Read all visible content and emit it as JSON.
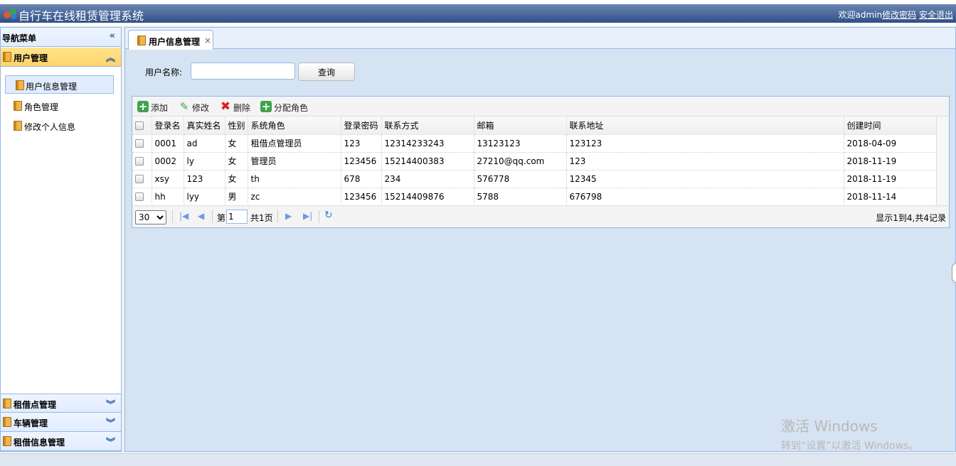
{
  "header": {
    "title": "自行车在线租赁管理系统",
    "welcome": "欢迎admin",
    "change_password": "修改密码",
    "logout": "安全退出"
  },
  "sidebar": {
    "nav_title": "导航菜单",
    "sections": [
      {
        "label": "用户管理",
        "expanded": true
      },
      {
        "label": "租借点管理",
        "expanded": false
      },
      {
        "label": "车辆管理",
        "expanded": false
      },
      {
        "label": "租借信息管理",
        "expanded": false
      }
    ],
    "items": [
      {
        "label": "用户信息管理",
        "selected": true
      },
      {
        "label": "角色管理",
        "selected": false
      },
      {
        "label": "修改个人信息",
        "selected": false
      }
    ]
  },
  "tabs": [
    {
      "label": "用户信息管理",
      "closable": true
    }
  ],
  "search": {
    "label": "用户名称:",
    "value": "",
    "button": "查询"
  },
  "toolbar": {
    "add": "添加",
    "edit": "修改",
    "delete": "删除",
    "assign_role": "分配角色"
  },
  "table": {
    "columns": [
      "登录名",
      "真实姓名",
      "性别",
      "系统角色",
      "登录密码",
      "联系方式",
      "邮箱",
      "联系地址",
      "创建时间"
    ],
    "rows": [
      [
        "0001",
        "ad",
        "女",
        "租借点管理员",
        "123",
        "12314233243",
        "13123123",
        "123123",
        "2018-04-09"
      ],
      [
        "0002",
        "ly",
        "女",
        "管理员",
        "123456",
        "15214400383",
        "27210@qq.com",
        "123",
        "2018-11-19"
      ],
      [
        "xsy",
        "123",
        "女",
        "th",
        "678",
        "234",
        "576778",
        "12345",
        "2018-11-19"
      ],
      [
        "hh",
        "lyy",
        "男",
        "zc",
        "123456",
        "15214409876",
        "5788",
        "676798",
        "2018-11-14"
      ]
    ]
  },
  "pager": {
    "page_size": "30",
    "page_prefix": "第",
    "current_page": "1",
    "total_pages": "共1页",
    "info": "显示1到4,共4记录"
  },
  "watermark": {
    "line1": "激活 Windows",
    "line2": "转到“设置”以激活 Windows。"
  },
  "colors": {
    "header_blue": "#2f4f86",
    "border_blue": "#95b8e7",
    "active_section": "#ffd36b"
  }
}
